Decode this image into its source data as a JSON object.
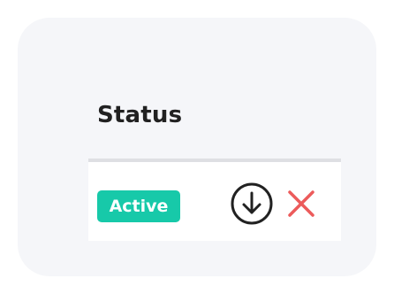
{
  "table": {
    "column_header": "Status",
    "rows": [
      {
        "status": "Active",
        "status_color": "#17c9a9",
        "actions": [
          {
            "icon": "download-icon",
            "color": "#212121"
          },
          {
            "icon": "close-icon",
            "color": "#ec5b5b"
          }
        ]
      }
    ]
  }
}
